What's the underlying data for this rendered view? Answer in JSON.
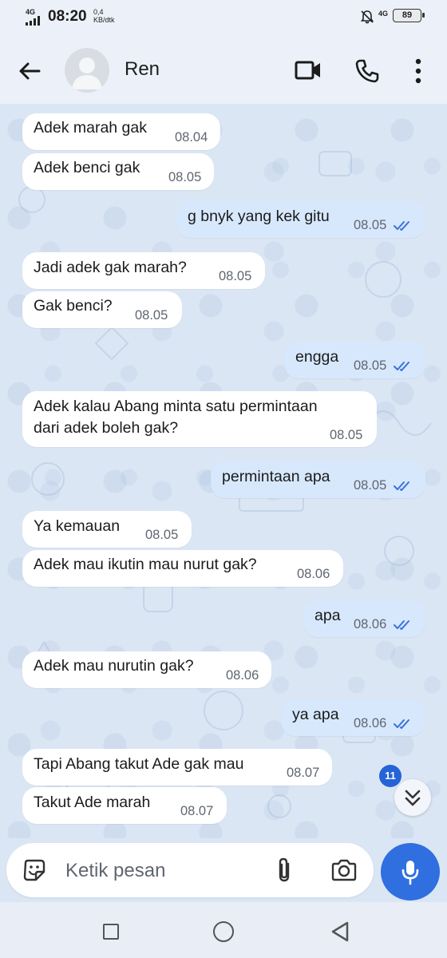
{
  "status_bar": {
    "network": "4G",
    "time": "08:20",
    "speed_value": "0,4",
    "speed_unit": "KB/dtk",
    "network_right": "4G",
    "battery": "89"
  },
  "header": {
    "contact_name": "Ren"
  },
  "messages": [
    {
      "dir": "in",
      "text": "Adek marah gak",
      "time": "08.04"
    },
    {
      "dir": "in",
      "text": "Adek benci gak",
      "time": "08.05"
    },
    {
      "dir": "out",
      "text": "g bnyk yang kek gitu",
      "time": "08.05",
      "read": true
    },
    {
      "dir": "in",
      "text": "Jadi adek gak marah?",
      "time": "08.05"
    },
    {
      "dir": "in",
      "text": "Gak benci?",
      "time": "08.05"
    },
    {
      "dir": "out",
      "text": "engga",
      "time": "08.05",
      "read": true
    },
    {
      "dir": "in",
      "text": "Adek kalau Abang minta satu permintaan\ndari adek boleh gak?",
      "time": "08.05"
    },
    {
      "dir": "out",
      "text": "permintaan apa",
      "time": "08.05",
      "read": true
    },
    {
      "dir": "in",
      "text": "Ya kemauan",
      "time": "08.05"
    },
    {
      "dir": "in",
      "text": "Adek mau ikutin mau nurut gak?",
      "time": "08.06"
    },
    {
      "dir": "out",
      "text": "apa",
      "time": "08.06",
      "read": true
    },
    {
      "dir": "in",
      "text": "Adek mau nurutin gak?",
      "time": "08.06"
    },
    {
      "dir": "out",
      "text": "ya apa",
      "time": "08.06",
      "read": true
    },
    {
      "dir": "in",
      "text": "Tapi Abang takut Ade gak mau",
      "time": "08.07"
    },
    {
      "dir": "in",
      "text": "Takut Ade marah",
      "time": "08.07"
    }
  ],
  "unread_badge": "11",
  "composer": {
    "placeholder": "Ketik pesan"
  },
  "colors": {
    "accent": "#2f6fe0",
    "outgoing_bubble": "#d7e8fd",
    "incoming_bubble": "#ffffff",
    "read_ticks": "#3a72d9"
  }
}
